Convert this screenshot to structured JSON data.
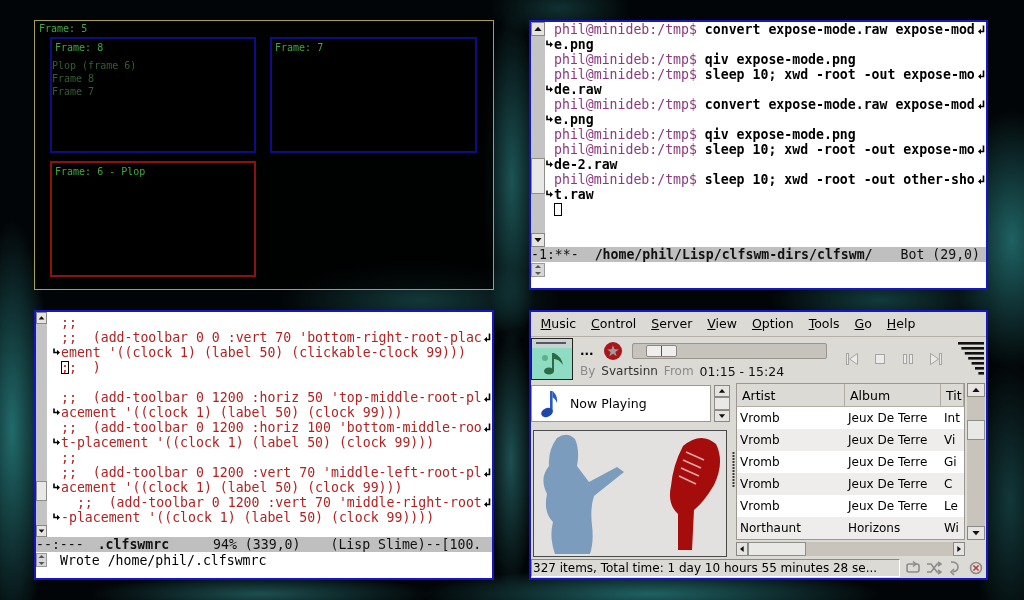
{
  "frame_tree": {
    "label": "Frame: 5",
    "windows": [
      "Plop (frame 6)",
      "Frame 8",
      "Frame 7"
    ],
    "frames": [
      {
        "label": "Frame: 8",
        "selected": false
      },
      {
        "label": "Frame: 7",
        "selected": false
      },
      {
        "label": "Frame: 6 - Plop",
        "selected": true
      }
    ]
  },
  "terminal": {
    "lines": [
      {
        "prompt": "phil@minideb:/tmp$",
        "text": "convert expose-mode.raw expose-mod",
        "wraps": true,
        "cursor": false
      },
      {
        "text": "e.png",
        "wraps": false,
        "cursor": false
      },
      {
        "prompt": "phil@minideb:/tmp$",
        "text": "qiv expose-mode.png",
        "wraps": false,
        "cursor": false
      },
      {
        "prompt": "phil@minideb:/tmp$",
        "text": "sleep 10; xwd -root -out expose-mo",
        "wraps": true,
        "cursor": false
      },
      {
        "text": "de.raw",
        "wraps": false,
        "cursor": false
      },
      {
        "prompt": "phil@minideb:/tmp$",
        "text": "convert expose-mode.raw expose-mod",
        "wraps": true,
        "cursor": false
      },
      {
        "text": "e.png",
        "wraps": false,
        "cursor": false
      },
      {
        "prompt": "phil@minideb:/tmp$",
        "text": "qiv expose-mode.png",
        "wraps": false,
        "cursor": false
      },
      {
        "prompt": "phil@minideb:/tmp$",
        "text": "sleep 10; xwd -root -out expose-mo",
        "wraps": true,
        "cursor": false
      },
      {
        "text": "de-2.raw",
        "wraps": false,
        "cursor": false
      },
      {
        "prompt": "phil@minideb:/tmp$",
        "text": "sleep 10; xwd -root -out other-sho",
        "wraps": true,
        "cursor": false
      },
      {
        "text": "t.raw",
        "wraps": false,
        "cursor": false
      },
      {
        "wraps": false,
        "cursor": true
      }
    ],
    "mode_line": {
      "status": "-1:**-",
      "buffer": "/home/phil/Lisp/clfswm-dirs/clfswm/",
      "position": "Bot (29,0)"
    }
  },
  "editor": {
    "lines": [
      {
        "text": ";;",
        "wraps": false,
        "cursor": false
      },
      {
        "text": ";;  (add-toolbar 0 0 :vert 70 'bottom-right-root-plac",
        "wraps": true,
        "cursor": false
      },
      {
        "text": "ement '((clock 1) (label 50) (clickable-clock 99)))",
        "wraps": false,
        "cursor": false
      },
      {
        "text": ";;  )",
        "wraps": false,
        "cursor": true
      },
      {
        "wraps": false,
        "cursor": false
      },
      {
        "text": ";;  (add-toolbar 0 1200 :horiz 50 'top-middle-root-pl",
        "wraps": true,
        "cursor": false
      },
      {
        "text": "acement '((clock 1) (label 50) (clock 99)))",
        "wraps": false,
        "cursor": false
      },
      {
        "text": ";;  (add-toolbar 0 1200 :horiz 100 'bottom-middle-roo",
        "wraps": true,
        "cursor": false
      },
      {
        "text": "t-placement '((clock 1) (label 50) (clock 99)))",
        "wraps": false,
        "cursor": false
      },
      {
        "text": ";;",
        "wraps": false,
        "cursor": false
      },
      {
        "text": ";;  (add-toolbar 0 1200 :vert 70 'middle-left-root-pl",
        "wraps": true,
        "cursor": false
      },
      {
        "text": "acement '((clock 1) (label 50) (clock 99)))",
        "wraps": false,
        "cursor": false
      },
      {
        "text": "  ;;  (add-toolbar 0 1200 :vert 70 'middle-right-root",
        "wraps": true,
        "cursor": false
      },
      {
        "text": "-placement '((clock 1) (label 50) (clock 99))))",
        "wraps": false,
        "cursor": false
      }
    ],
    "mode_line": {
      "status": "--:---",
      "buffer": ".clfswmrc",
      "position": "94% (339,0)",
      "modes": "(Lisp Slime)--[100."
    },
    "echo_area": "Wrote /home/phil/.clfswmrc"
  },
  "player": {
    "menu": [
      "Music",
      "Control",
      "Server",
      "View",
      "Option",
      "Tools",
      "Go",
      "Help"
    ],
    "now_playing": {
      "title": "...",
      "by_label": "By",
      "artist": "Svartsinn",
      "from_label": "From",
      "time": "01:15 - 15:24"
    },
    "seek": {
      "level": 0.08
    },
    "sources": [
      {
        "label": "Now Playing",
        "selected": false
      }
    ],
    "playlist": {
      "columns": [
        "Artist",
        "Album",
        "Tit"
      ],
      "rows": [
        {
          "cells": [
            "Vromb",
            "Jeux De Terre",
            "Int"
          ],
          "selected": false
        },
        {
          "cells": [
            "Vromb",
            "Jeux De Terre",
            "Vi"
          ],
          "selected": false
        },
        {
          "cells": [
            "Vromb",
            "Jeux De Terre",
            "Gi"
          ],
          "selected": false
        },
        {
          "cells": [
            "Vromb",
            "Jeux De Terre",
            "C"
          ],
          "selected": false
        },
        {
          "cells": [
            "Vromb",
            "Jeux De Terre",
            "Le"
          ],
          "selected": false
        },
        {
          "cells": [
            "Northaunt",
            "Horizons",
            "Wi"
          ],
          "selected": false
        }
      ]
    },
    "status": "327 items, Total time: 1 day 10 hours 55 minutes 28 se..."
  }
}
